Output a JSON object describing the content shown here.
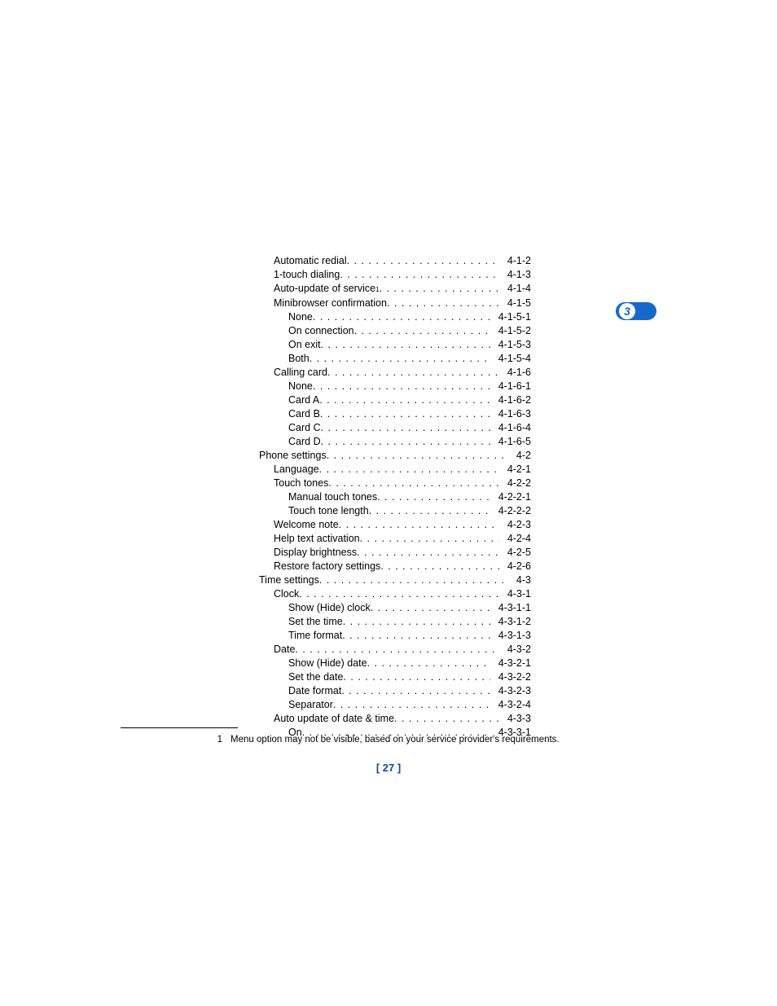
{
  "page_number": "[ 27 ]",
  "tab_number": "3",
  "footnote": {
    "marker": "1",
    "text": "Menu option may not be visible, based on your service provider's requirements."
  },
  "toc": [
    {
      "indent": 2,
      "label": "Automatic redial",
      "num": "4-1-2"
    },
    {
      "indent": 2,
      "label": "1-touch dialing",
      "num": "4-1-3"
    },
    {
      "indent": 2,
      "label": "Auto-update of service",
      "sup": "1",
      "num": "4-1-4"
    },
    {
      "indent": 2,
      "label": "Minibrowser confirmation",
      "num": "4-1-5"
    },
    {
      "indent": 3,
      "label": "None",
      "num": "4-1-5-1"
    },
    {
      "indent": 3,
      "label": "On connection",
      "num": "4-1-5-2"
    },
    {
      "indent": 3,
      "label": "On exit",
      "num": "4-1-5-3"
    },
    {
      "indent": 3,
      "label": "Both",
      "num": "4-1-5-4"
    },
    {
      "indent": 2,
      "label": "Calling card",
      "num": "4-1-6"
    },
    {
      "indent": 3,
      "label": "None",
      "num": "4-1-6-1"
    },
    {
      "indent": 3,
      "label": "Card A",
      "num": "4-1-6-2"
    },
    {
      "indent": 3,
      "label": "Card B",
      "num": "4-1-6-3"
    },
    {
      "indent": 3,
      "label": "Card C",
      "num": "4-1-6-4"
    },
    {
      "indent": 3,
      "label": "Card D",
      "num": "4-1-6-5"
    },
    {
      "indent": 1,
      "label": "Phone settings",
      "num": "4-2"
    },
    {
      "indent": 2,
      "label": "Language",
      "num": "4-2-1"
    },
    {
      "indent": 2,
      "label": "Touch tones",
      "num": "4-2-2"
    },
    {
      "indent": 3,
      "label": "Manual touch tones",
      "num": "4-2-2-1"
    },
    {
      "indent": 3,
      "label": "Touch tone length",
      "num": "4-2-2-2"
    },
    {
      "indent": 2,
      "label": "Welcome note",
      "num": "4-2-3"
    },
    {
      "indent": 2,
      "label": "Help text activation",
      "num": "4-2-4"
    },
    {
      "indent": 2,
      "label": "Display brightness",
      "num": "4-2-5"
    },
    {
      "indent": 2,
      "label": "Restore factory settings",
      "num": "4-2-6"
    },
    {
      "indent": 1,
      "label": "Time settings",
      "num": "4-3"
    },
    {
      "indent": 2,
      "label": "Clock",
      "num": "4-3-1"
    },
    {
      "indent": 3,
      "label": "Show (Hide) clock",
      "num": "4-3-1-1"
    },
    {
      "indent": 3,
      "label": "Set the time",
      "num": "4-3-1-2"
    },
    {
      "indent": 3,
      "label": "Time format",
      "num": "4-3-1-3"
    },
    {
      "indent": 2,
      "label": "Date",
      "num": "4-3-2"
    },
    {
      "indent": 3,
      "label": "Show (Hide) date",
      "num": "4-3-2-1"
    },
    {
      "indent": 3,
      "label": "Set the date",
      "num": "4-3-2-2"
    },
    {
      "indent": 3,
      "label": "Date format",
      "num": "4-3-2-3"
    },
    {
      "indent": 3,
      "label": "Separator",
      "num": "4-3-2-4"
    },
    {
      "indent": 2,
      "label": "Auto update of date & time",
      "num": "4-3-3"
    },
    {
      "indent": 3,
      "label": "On",
      "num": "4-3-3-1"
    }
  ]
}
